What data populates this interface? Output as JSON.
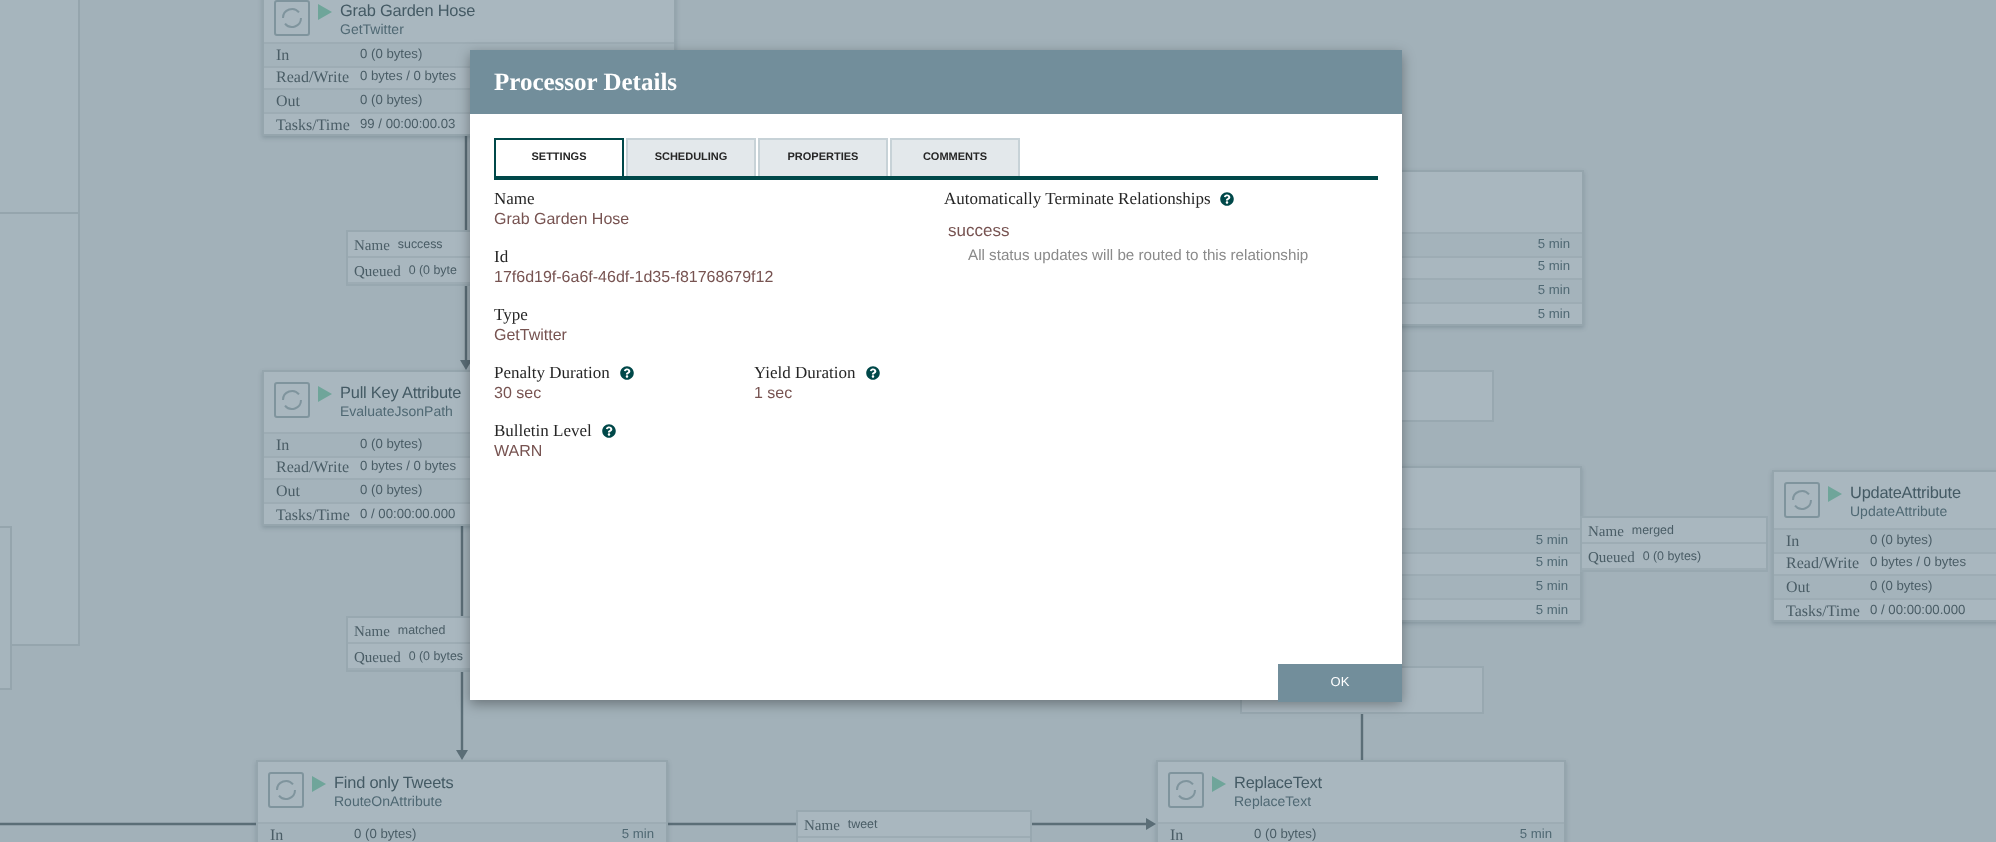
{
  "canvas": {
    "processors": [
      {
        "name": "Grab Garden Hose",
        "type": "GetTwitter",
        "rows": [
          {
            "label": "In",
            "value": "0 (0 bytes)"
          },
          {
            "label": "Read/Write",
            "value": "0 bytes / 0 bytes"
          },
          {
            "label": "Out",
            "value": "0 (0 bytes)"
          },
          {
            "label": "Tasks/Time",
            "value": "99 / 00:00:00.03"
          }
        ]
      },
      {
        "name": "Pull Key Attribute",
        "type": "EvaluateJsonPath",
        "rows": [
          {
            "label": "In",
            "value": "0 (0 bytes)"
          },
          {
            "label": "Read/Write",
            "value": "0 bytes / 0 bytes"
          },
          {
            "label": "Out",
            "value": "0 (0 bytes)"
          },
          {
            "label": "Tasks/Time",
            "value": "0 / 00:00:00.000"
          }
        ]
      },
      {
        "name": "Find only Tweets",
        "type": "RouteOnAttribute",
        "rows": [
          {
            "label": "In",
            "value": "0 (0 bytes)",
            "time": "5 min"
          }
        ]
      },
      {
        "name": "ReplaceText",
        "type": "ReplaceText",
        "rows": [
          {
            "label": "In",
            "value": "0 (0 bytes)",
            "time": "5 min"
          }
        ]
      },
      {
        "name": "UpdateAttribute",
        "type": "UpdateAttribute",
        "rows": [
          {
            "label": "In",
            "value": "0 (0 bytes)"
          },
          {
            "label": "Read/Write",
            "value": "0 bytes / 0 bytes"
          },
          {
            "label": "Out",
            "value": "0 (0 bytes)"
          },
          {
            "label": "Tasks/Time",
            "value": "0 / 00:00:00.000"
          }
        ]
      },
      {
        "rows": [
          {
            "time": "5 min"
          },
          {
            "time": "5 min"
          },
          {
            "time": "5 min"
          },
          {
            "time": "5 min"
          }
        ]
      },
      {
        "rows": [
          {
            "time": "5 min"
          },
          {
            "time": "5 min"
          },
          {
            "time": "5 min"
          },
          {
            "time": "5 min"
          }
        ]
      }
    ],
    "connections": [
      {
        "name_key": "Name",
        "name": "success",
        "queued_key": "Queued",
        "queued": "0 (0 byte"
      },
      {
        "name_key": "Name",
        "name": "matched",
        "queued_key": "Queued",
        "queued": "0 (0 bytes"
      },
      {
        "name_key": "Name",
        "name": "merged",
        "queued_key": "Queued",
        "queued": "0 (0 bytes)"
      },
      {
        "name_key": "Name",
        "name": "tweet"
      }
    ]
  },
  "dialog": {
    "title": "Processor Details",
    "tabs": [
      {
        "label": "SETTINGS",
        "selected": true
      },
      {
        "label": "SCHEDULING",
        "selected": false
      },
      {
        "label": "PROPERTIES",
        "selected": false
      },
      {
        "label": "COMMENTS",
        "selected": false
      }
    ],
    "name": {
      "label": "Name",
      "value": "Grab Garden Hose"
    },
    "id": {
      "label": "Id",
      "value": "17f6d19f-6a6f-46df-1d35-f81768679f12"
    },
    "type": {
      "label": "Type",
      "value": "GetTwitter"
    },
    "penalty": {
      "label": "Penalty Duration",
      "value": "30 sec"
    },
    "yield": {
      "label": "Yield Duration",
      "value": "1 sec"
    },
    "bulletin": {
      "label": "Bulletin Level",
      "value": "WARN"
    },
    "relationships_label": "Automatically Terminate Relationships",
    "relationships": [
      {
        "name": "success",
        "description": "All status updates will be routed to this relationship"
      }
    ],
    "button": "OK"
  }
}
